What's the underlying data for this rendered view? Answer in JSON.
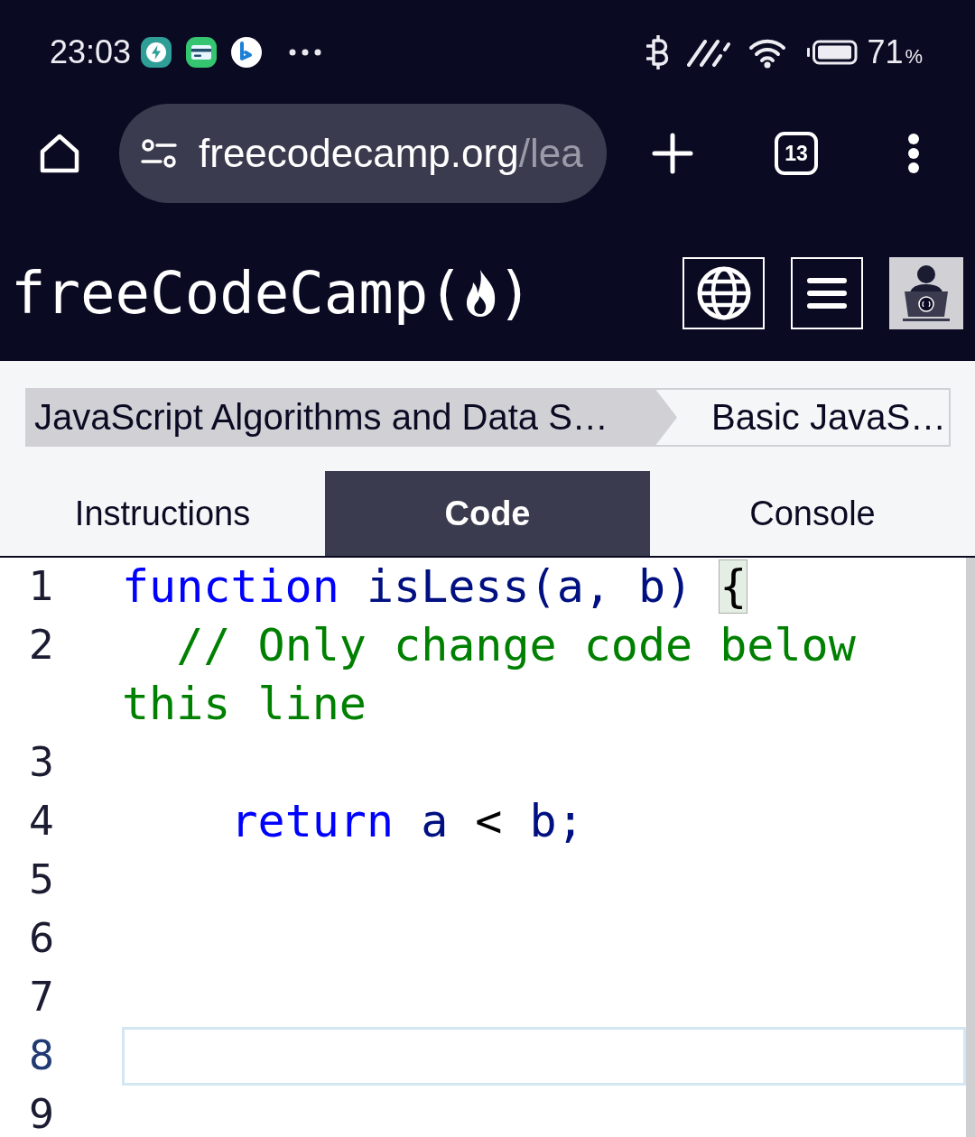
{
  "status_bar": {
    "time": "23:03",
    "battery_value": "71",
    "battery_unit": "%"
  },
  "browser_bar": {
    "address_host": "freecodecamp.org",
    "address_path": "/lea",
    "tab_count": "13"
  },
  "navbar": {
    "logo": {
      "text": "freeCodeCamp",
      "open": "(",
      "close": ")"
    }
  },
  "breadcrumbs": [
    {
      "kind": "parent",
      "label": "JavaScript Algorithms and Data S…"
    },
    {
      "kind": "current",
      "label": "Basic JavaS…"
    }
  ],
  "tabs": [
    {
      "label": "Instructions",
      "selected": false
    },
    {
      "label": "Code",
      "selected": true
    },
    {
      "label": "Console",
      "selected": false
    }
  ],
  "editor": {
    "lines": [
      {
        "number": "1",
        "selected": false,
        "tokens": [
          {
            "kind": "keyword",
            "text": "function"
          },
          {
            "kind": "plain",
            "text": " isLess(a, b) "
          },
          {
            "kind": "matched-bracket",
            "text": "{"
          }
        ]
      },
      {
        "number": "2",
        "selected": false,
        "tokens": [
          {
            "kind": "comment",
            "text": "  // Only change code below this line"
          }
        ]
      },
      {
        "number": "3",
        "selected": false
      },
      {
        "number": "4",
        "selected": false,
        "tokens": [
          {
            "kind": "keyword",
            "text": "    return"
          },
          {
            "kind": "plain",
            "text": " a "
          },
          {
            "kind": "operator",
            "text": "<"
          },
          {
            "kind": "plain",
            "text": " b;"
          }
        ]
      },
      {
        "number": "5",
        "selected": false
      },
      {
        "number": "6",
        "selected": false
      },
      {
        "number": "7",
        "selected": false
      },
      {
        "number": "8",
        "selected": true
      },
      {
        "number": "9",
        "selected": false
      }
    ]
  }
}
